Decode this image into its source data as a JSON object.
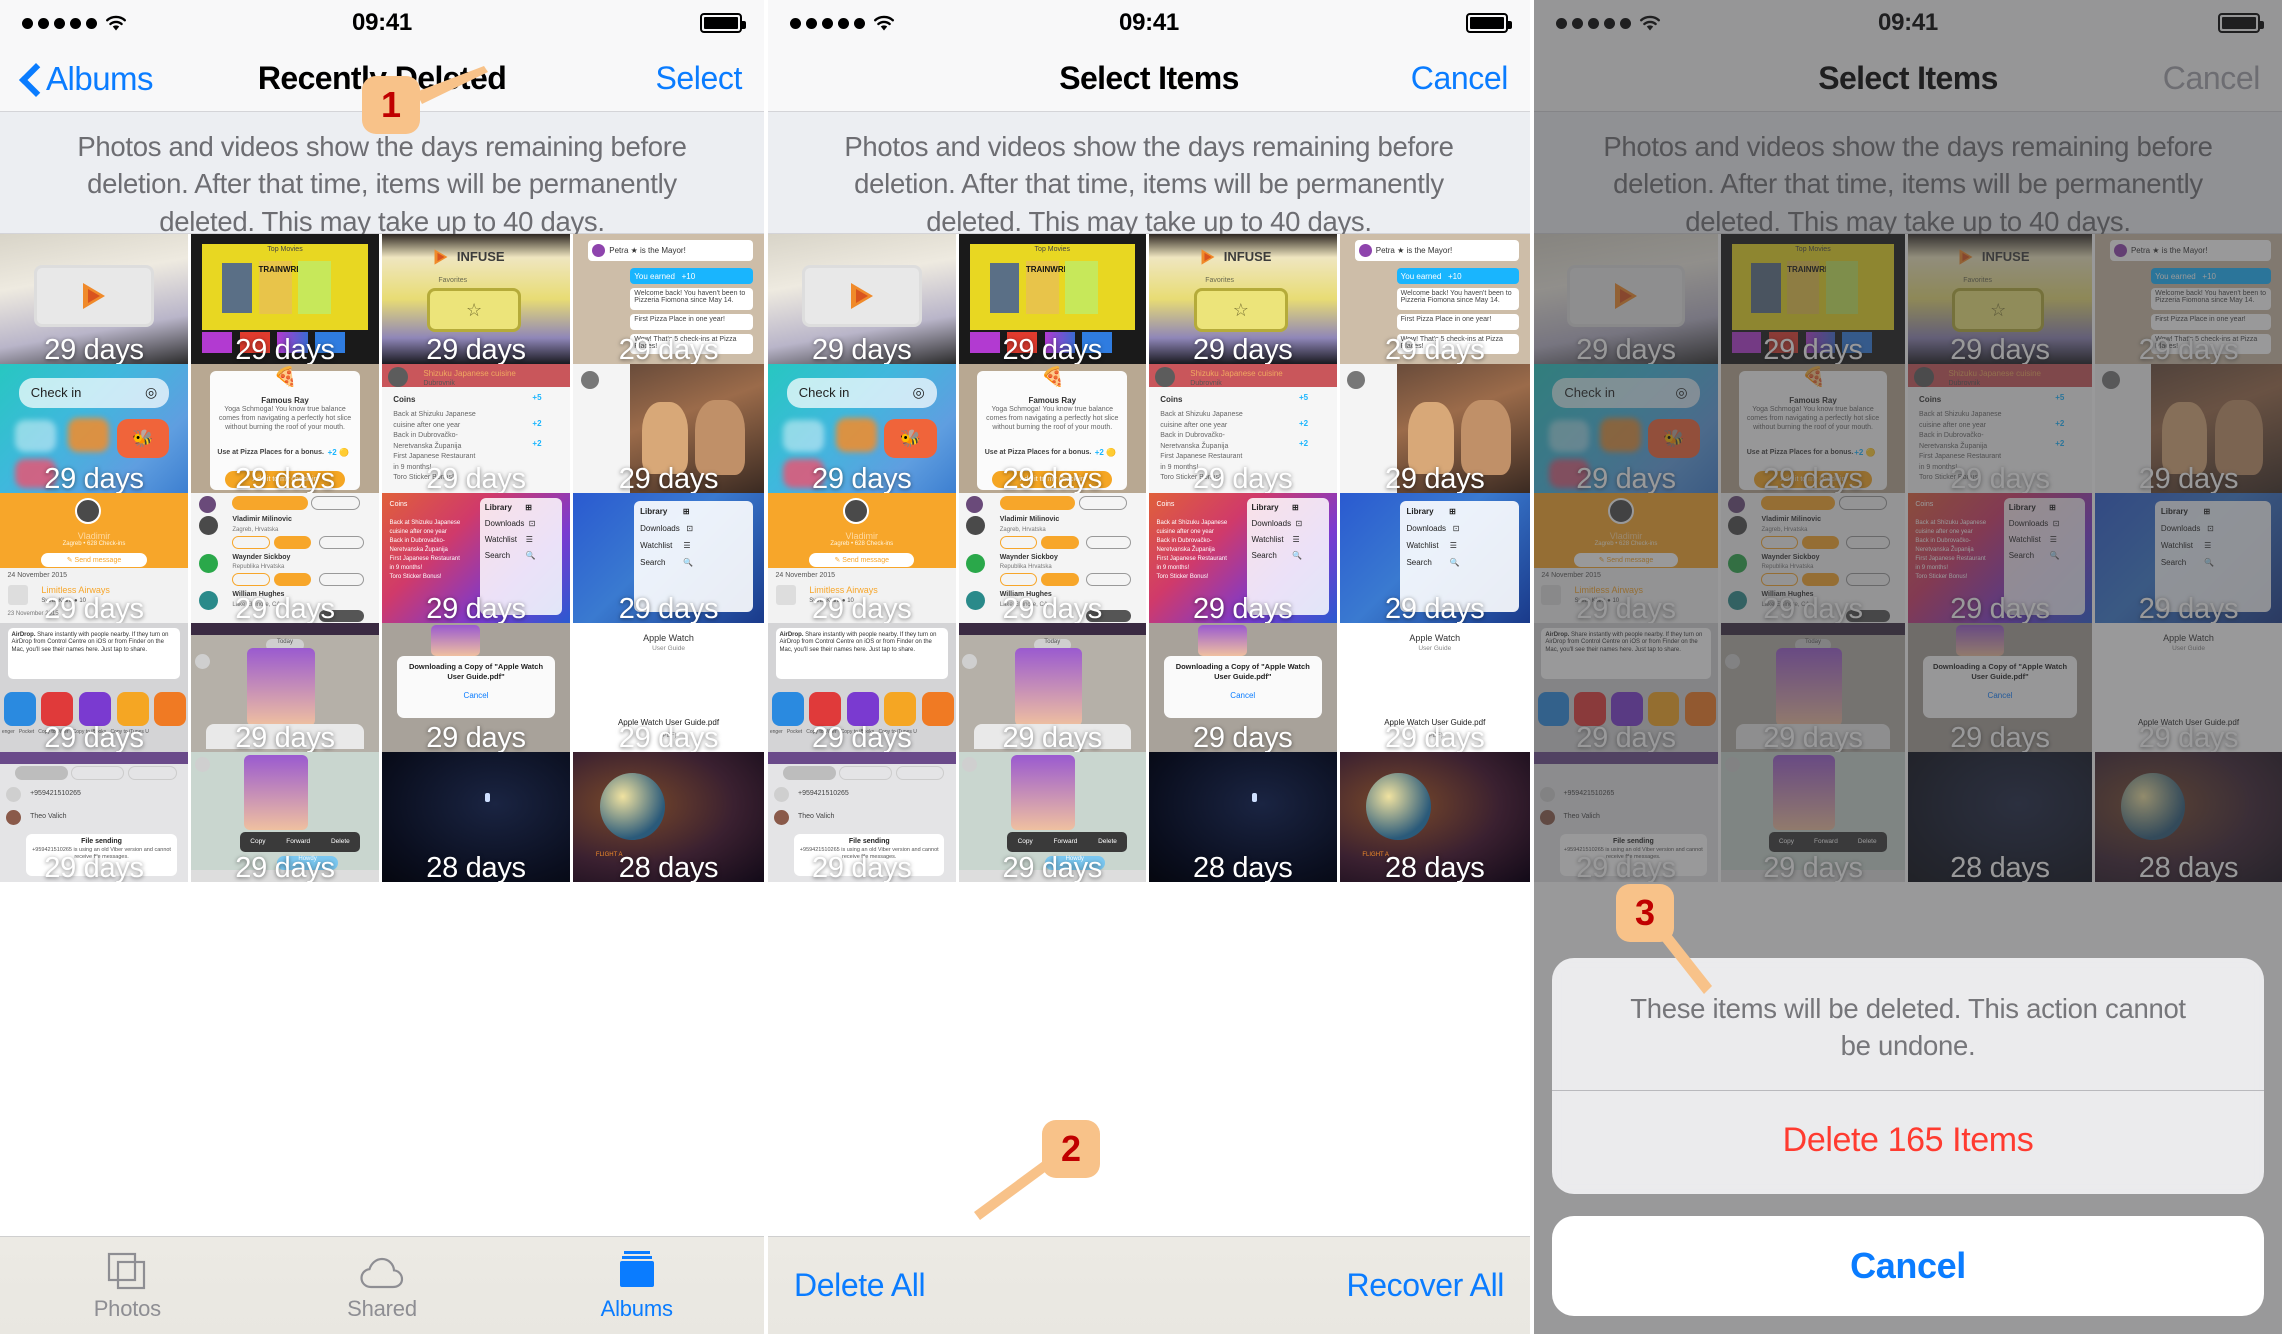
{
  "status_bar": {
    "time": "09:41",
    "signal_dots": 5,
    "wifi_icon": "wifi-icon",
    "battery_icon": "battery-full-icon"
  },
  "panels": [
    {
      "id": "recently-deleted",
      "nav": {
        "back_label": "Albums",
        "back_icon": "chevron-left-icon",
        "title": "Recently Deleted",
        "action_label": "Select"
      },
      "info_text": "Photos and videos show the days remaining before deletion. After that time, items will be permanently deleted. This may take up to 40 days.",
      "tabs": [
        {
          "label": "Photos",
          "icon": "photos-icon",
          "active": false
        },
        {
          "label": "Shared",
          "icon": "cloud-icon",
          "active": false
        },
        {
          "label": "Albums",
          "icon": "albums-icon",
          "active": true
        }
      ]
    },
    {
      "id": "select-items",
      "nav": {
        "title": "Select Items",
        "action_label": "Cancel"
      },
      "info_text": "Photos and videos show the days remaining before deletion. After that time, items will be permanently deleted. This may take up to 40 days.",
      "toolbar": {
        "delete_all_label": "Delete All",
        "recover_all_label": "Recover All"
      }
    },
    {
      "id": "confirm-delete",
      "nav": {
        "title": "Select Items",
        "action_label": "Cancel"
      },
      "info_text": "Photos and videos show the days remaining before deletion. After that time, items will be permanently deleted. This may take up to 40 days.",
      "action_sheet": {
        "message": "These items will be deleted. This action cannot be undone.",
        "destructive_label": "Delete 165 Items",
        "cancel_label": "Cancel"
      }
    }
  ],
  "grid": {
    "day_labels": [
      [
        "29 days",
        "29 days",
        "29 days",
        "29 days"
      ],
      [
        "29 days",
        "29 days",
        "29 days",
        "29 days"
      ],
      [
        "29 days",
        "29 days",
        "29 days",
        "29 days"
      ],
      [
        "29 days",
        "29 days",
        "29 days",
        "29 days"
      ],
      [
        "29 days",
        "29 days",
        "28 days",
        "28 days"
      ]
    ],
    "thumbnail_names": [
      [
        "appletv-infuse-pro",
        "appletv-top-movies",
        "appletv-infuse-favorites",
        "foursquare-mayor"
      ],
      [
        "ios-checkin-widget",
        "foursquare-famous-ray",
        "foursquare-shizuku-coins",
        "friends-photo"
      ],
      [
        "foursquare-profile-vladimir",
        "viber-contacts-list",
        "library-downloads-menu",
        "library-downloads-menu-2"
      ],
      [
        "airdrop-share-sheet",
        "viber-sticker-chat",
        "downloading-pdf-dialog",
        "apple-watch-user-guide-pdf"
      ],
      [
        "viber-file-sending",
        "viber-copy-forward-delete",
        "night-sky-photo",
        "planet-flight-photo"
      ]
    ]
  },
  "callouts": [
    {
      "number": "1",
      "points_to": "Select"
    },
    {
      "number": "2",
      "points_to": "Delete All"
    },
    {
      "number": "3",
      "points_to": "Delete 165 Items"
    }
  ],
  "colors": {
    "accent_blue": "#0a7cff",
    "destructive_red": "#ff3b30",
    "badge_bg": "#f8c289",
    "badge_text": "#c00000",
    "info_bg": "#eceef2"
  }
}
